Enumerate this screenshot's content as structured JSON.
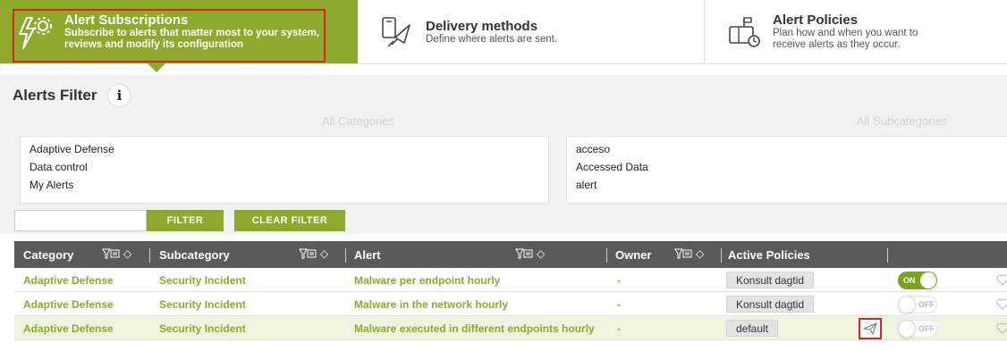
{
  "tabs": {
    "subscriptions": {
      "title": "Alert Subscriptions",
      "subtitle_line1": "Subscribe to alerts that matter most to your system,",
      "subtitle_line2": "reviews and modify its configuration"
    },
    "delivery": {
      "title": "Delivery methods",
      "subtitle_line1": "Define where alerts are sent."
    },
    "policies": {
      "title": "Alert Policies",
      "subtitle_line1": "Plan how and when you want to",
      "subtitle_line2": "receive alerts as they occur."
    }
  },
  "filter": {
    "title": "Alerts Filter",
    "info_glyph": "i",
    "categories_header": "All Categories",
    "subcategories_header": "All Subcategories",
    "categories": [
      "Adaptive Defense",
      "Data control",
      "My Alerts"
    ],
    "subcategories": [
      "acceso",
      "Accessed Data",
      "alert"
    ],
    "search_value": "",
    "filter_button": "FILTER",
    "clear_button": "CLEAR FILTER"
  },
  "table": {
    "headers": {
      "category": "Category",
      "subcategory": "Subcategory",
      "alert": "Alert",
      "owner": "Owner",
      "policies": "Active Policies"
    },
    "sort_glyph": "◇",
    "rows": [
      {
        "category": "Adaptive Defense",
        "subcategory": "Security Incident",
        "alert": "Malware per endpoint hourly",
        "owner": "-",
        "policy": "Konsult dagtid",
        "toggle": "ON"
      },
      {
        "category": "Adaptive Defense",
        "subcategory": "Security Incident",
        "alert": "Malware in the network hourly",
        "owner": "-",
        "policy": "Konsult dagtid",
        "toggle": "OFF"
      },
      {
        "category": "Adaptive Defense",
        "subcategory": "Security Incident",
        "alert": "Malware executed in different endpoints hourly",
        "owner": "-",
        "policy": "default",
        "toggle": "OFF"
      }
    ]
  },
  "colors": {
    "accent": "#8eaa2d",
    "header_bg": "#5a5a5a",
    "highlight": "#d9271f",
    "selected_row": "#eef4dd"
  },
  "icons": {
    "subscriptions": "bolt-gear-icon",
    "delivery": "phone-send-icon",
    "policies": "mailbox-clock-icon",
    "column_filter": "funnel-list-icon",
    "send": "paper-plane-icon",
    "favorite": "heart-icon"
  }
}
